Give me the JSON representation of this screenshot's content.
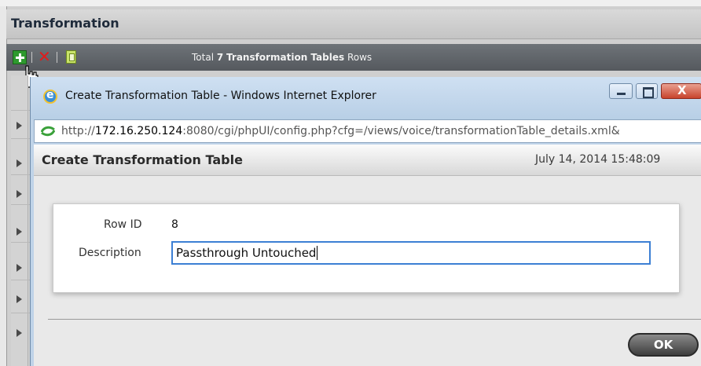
{
  "background_app": {
    "section_title": "Transformation",
    "toolbar": {
      "add_icon": "add-icon",
      "delete_icon": "delete-icon",
      "copy_icon": "copy-icon",
      "total_prefix": "Total",
      "total_count": "7",
      "total_entity": "Transformation Tables",
      "total_suffix": "Rows"
    },
    "row_count_visible": 8
  },
  "ie_window": {
    "title": "Create Transformation Table - Windows Internet Explorer",
    "address": {
      "scheme": "http://",
      "host": "172.16.250.124",
      "rest": ":8080/cgi/phpUI/config.php?cfg=/views/voice/transformationTable_details.xml&"
    },
    "close_glyph": "X"
  },
  "dialog": {
    "title": "Create Transformation Table",
    "datetime": "July 14, 2014 15:48:09",
    "row_id_label": "Row ID",
    "row_id_value": "8",
    "description_label": "Description",
    "description_value": "Passthrough Untouched",
    "ok_label": "OK"
  },
  "colors": {
    "toolbar_bg": "#5f6368",
    "ie_frame": "#bfd3e8",
    "input_focus_border": "#3c7fd4",
    "ok_button": "#4a4a4a"
  }
}
